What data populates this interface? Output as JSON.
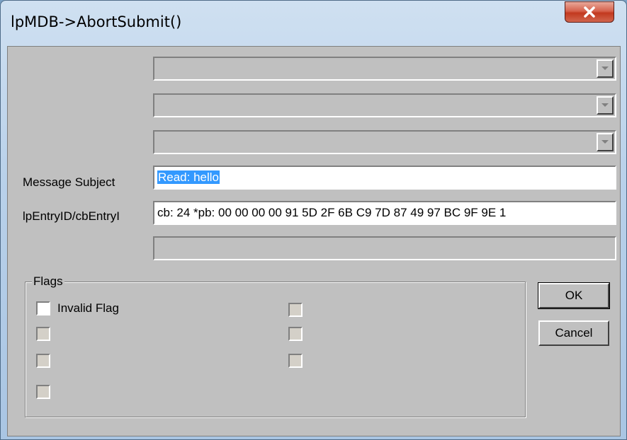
{
  "window": {
    "title": "lpMDB->AbortSubmit()",
    "close_icon": "close-icon"
  },
  "combos": [
    {
      "value": ""
    },
    {
      "value": ""
    },
    {
      "value": ""
    }
  ],
  "fields": {
    "subject_label": "Message Subject",
    "subject_value": "Read: hello",
    "entryid_label": "lpEntryID/cbEntryI",
    "entryid_value": "cb:  24     *pb: 00 00 00 00 91 5D 2F 6B C9 7D 87 49 97 BC 9F 9E 1",
    "extra_value": ""
  },
  "flags": {
    "legend": "Flags",
    "items": [
      {
        "label": "Invalid Flag",
        "checked": false
      },
      {
        "label": "",
        "checked": false
      },
      {
        "label": "",
        "checked": false
      },
      {
        "label": "",
        "checked": false
      },
      {
        "label": "",
        "checked": false
      },
      {
        "label": "",
        "checked": false
      },
      {
        "label": "",
        "checked": false
      }
    ]
  },
  "buttons": {
    "ok": "OK",
    "cancel": "Cancel"
  },
  "colors": {
    "face": "#c0c0c0",
    "selection": "#3399ff",
    "close_red": "#c2391f"
  }
}
